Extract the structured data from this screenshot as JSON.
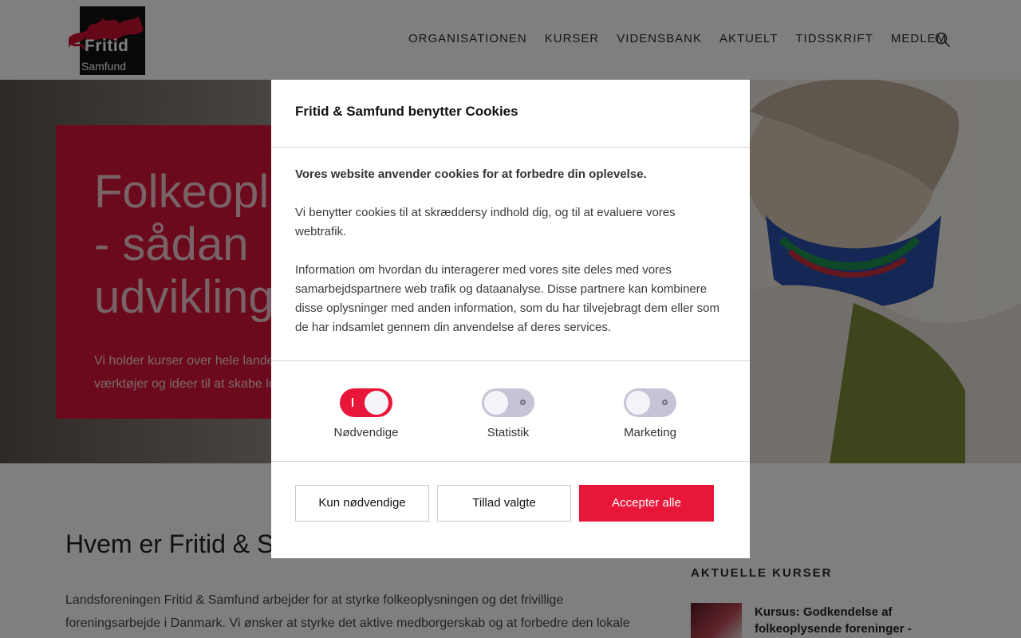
{
  "logo": {
    "text_line1": "Fritid",
    "text_line2": "Samfund"
  },
  "nav": {
    "items": [
      {
        "label": "ORGANISATIONEN"
      },
      {
        "label": "KURSER"
      },
      {
        "label": "VIDENSBANK"
      },
      {
        "label": "AKTUELT"
      },
      {
        "label": "TIDSSKRIFT"
      },
      {
        "label": "MEDLEM"
      }
    ],
    "search_icon": "search-icon"
  },
  "hero": {
    "title": "Folkeopl\n- sådan\nudvikling",
    "text": "Vi holder kurser over hele landet\nværktøjer og ideer til at skabe lok"
  },
  "main": {
    "title": "Hvem er Fritid & S",
    "body": "Landsforeningen Fritid & Samfund arbejder for at styrke folkeoplysningen og det frivillige foreningsarbejde i Danmark. Vi ønsker at styrke det aktive medborgerskab og at forbedre den lokale fritids- og kulturpolitik i"
  },
  "aside": {
    "heading": "AKTUELLE KURSER",
    "course_title": "Kursus: Godkendelse af folkeoplysende foreninger -"
  },
  "cookie_modal": {
    "title": "Fritid & Samfund benytter Cookies",
    "lead": "Vores website anvender cookies for at forbedre din oplevelse.",
    "paragraph1": "Vi benytter cookies til at skræddersy indhold dig, og til at evaluere vores webtrafik.",
    "paragraph2": "Information om hvordan du interagerer med vores site deles med vores samarbejdspartnere web trafik og dataanalyse. Disse partnere kan kombinere disse oplysninger med anden information, som du har tilvejebragt dem eller som de har indsamlet gennem din anvendelse af deres services.",
    "toggles": [
      {
        "label": "Nødvendige",
        "on": true
      },
      {
        "label": "Statistik",
        "on": false
      },
      {
        "label": "Marketing",
        "on": false
      }
    ],
    "buttons": {
      "necessary_only": "Kun nødvendige",
      "allow_selected": "Tillad valgte",
      "accept_all": "Accepter alle"
    }
  },
  "colors": {
    "accent": "#e8173a",
    "toggle_off": "#c7c3d6",
    "hero_card": "#d8143a"
  }
}
